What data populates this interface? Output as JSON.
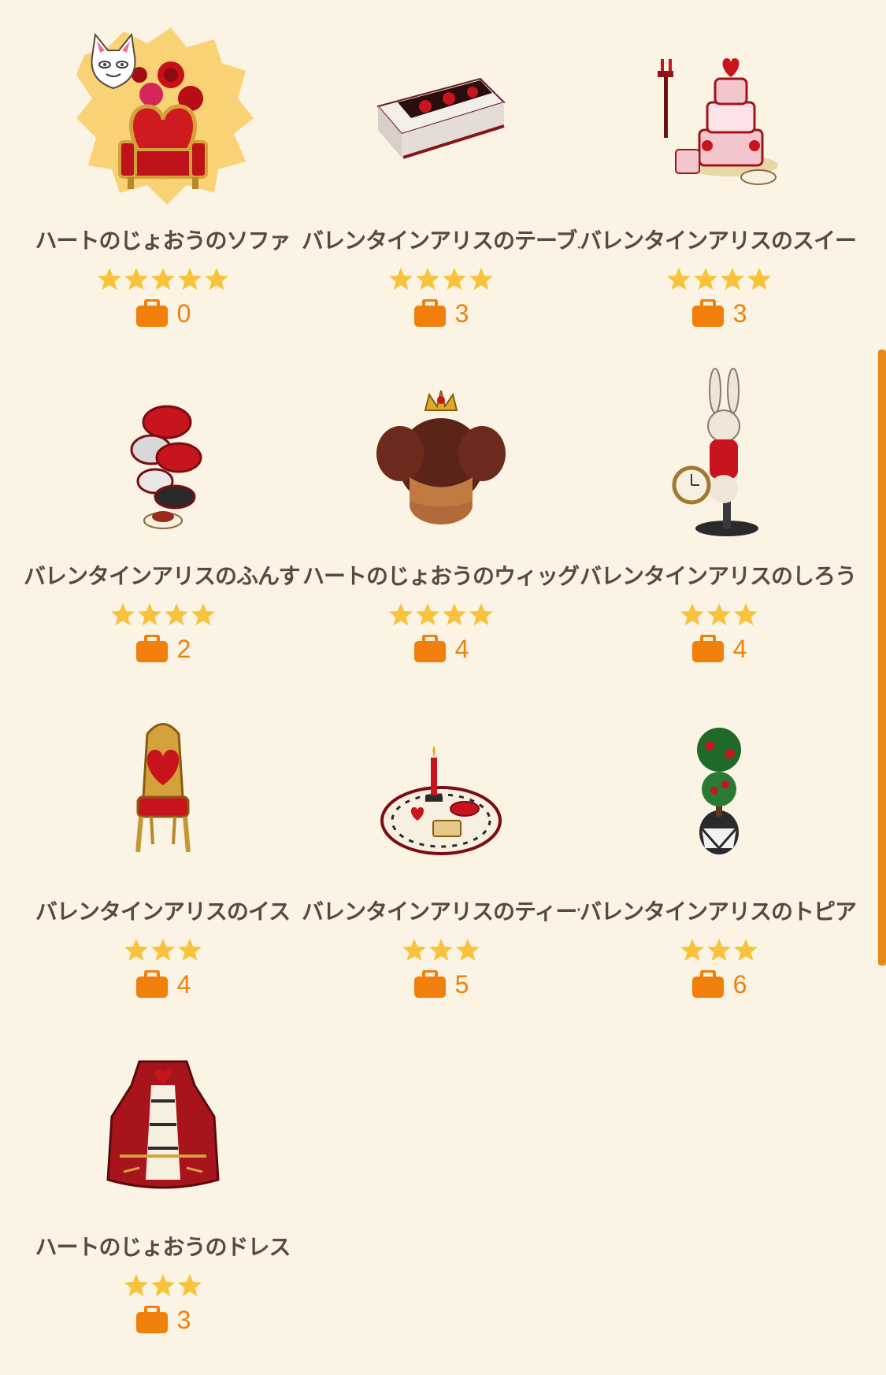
{
  "colors": {
    "background": "#fbf4e4",
    "name_text": "#5a4a3c",
    "star": "#f8c23a",
    "count_text": "#f07f0b",
    "scrollbar": "#e8891a"
  },
  "items": [
    {
      "name": "ハートのじょおうのソファ",
      "stars": 5,
      "count": "0",
      "icon": "heart-queen-sofa-icon",
      "featured": true
    },
    {
      "name": "バレンタインアリスのテーブル",
      "stars": 4,
      "count": "3",
      "icon": "valentine-table-icon"
    },
    {
      "name": "バレンタインアリスのスイーツ",
      "stars": 4,
      "count": "3",
      "icon": "valentine-sweets-icon"
    },
    {
      "name": "バレンタインアリスのふんすい",
      "stars": 4,
      "count": "2",
      "icon": "valentine-fountain-icon"
    },
    {
      "name": "ハートのじょおうのウィッグ",
      "stars": 4,
      "count": "4",
      "icon": "heart-queen-wig-icon"
    },
    {
      "name": "バレンタインアリスのしろうさぎ",
      "stars": 3,
      "count": "4",
      "icon": "white-rabbit-icon"
    },
    {
      "name": "バレンタインアリスのイス",
      "stars": 3,
      "count": "4",
      "icon": "valentine-chair-icon"
    },
    {
      "name": "バレンタインアリスのティーセット",
      "stars": 3,
      "count": "5",
      "icon": "valentine-tea-set-icon"
    },
    {
      "name": "バレンタインアリスのトピアリー",
      "stars": 3,
      "count": "6",
      "icon": "valentine-topiary-icon"
    },
    {
      "name": "ハートのじょおうのドレス",
      "stars": 3,
      "count": "3",
      "icon": "heart-queen-dress-icon"
    }
  ]
}
